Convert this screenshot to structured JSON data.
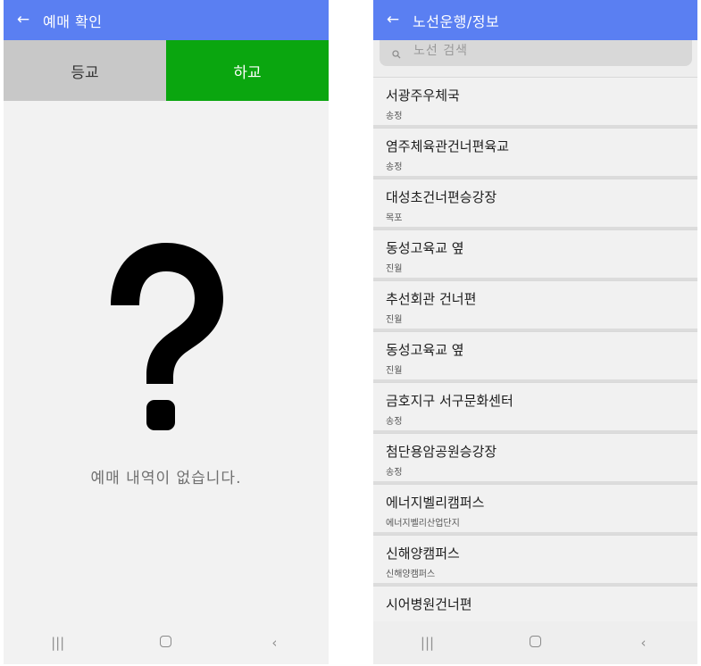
{
  "left_screen": {
    "title": "예매 확인",
    "back_icon": "←",
    "tabs": [
      {
        "label": "등교",
        "color": "#c8c8c8"
      },
      {
        "label": "하교",
        "color": "#0aa60f"
      }
    ],
    "empty_icon": "question-mark-icon",
    "empty_message": "예매 내역이 없습니다."
  },
  "right_screen": {
    "title": "노선운행/정보",
    "back_icon": "←",
    "search": {
      "placeholder": "노선 검색",
      "icon": "search-icon"
    },
    "routes": [
      {
        "name": "서광주우체국",
        "area": "송정"
      },
      {
        "name": "염주체육관건너편육교",
        "area": "송정"
      },
      {
        "name": "대성초건너편승강장",
        "area": "목포"
      },
      {
        "name": "동성고육교 옆",
        "area": "진월"
      },
      {
        "name": "추선회관 건너편",
        "area": "진월"
      },
      {
        "name": "동성고육교 옆",
        "area": "진월"
      },
      {
        "name": "금호지구 서구문화센터",
        "area": "송정"
      },
      {
        "name": "첨단용암공원승강장",
        "area": "송정"
      },
      {
        "name": "에너지벨리캠퍼스",
        "area": "에너지벨리산업단지"
      },
      {
        "name": "신해양캠퍼스",
        "area": "신해양캠퍼스"
      },
      {
        "name": "시어병원건너편",
        "area": ""
      }
    ]
  },
  "navigation_bar": {
    "recent_label": "|||",
    "back_label": "‹"
  },
  "colors": {
    "app_bar": "#5a7ff2",
    "active_tab": "#0aa60f",
    "inactive_tab": "#c8c8c8"
  }
}
